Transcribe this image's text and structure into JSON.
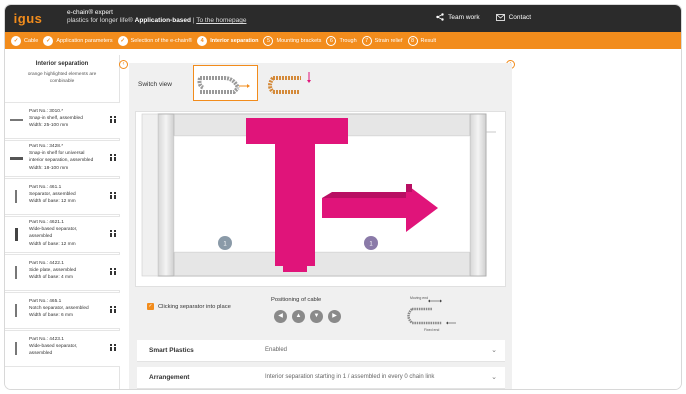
{
  "header": {
    "logo": "igus",
    "app_name": "e-chain® expert",
    "tagline": "plastics for longer life®",
    "mode": "Application-based",
    "separator": "|",
    "home_link": "To the homepage",
    "team_work": "Team work",
    "contact": "Contact"
  },
  "steps": [
    {
      "num": "✓",
      "label": "Cable",
      "state": "done"
    },
    {
      "num": "✓",
      "label": "Application parameters",
      "state": "done"
    },
    {
      "num": "✓",
      "label": "Selection of the e-chain®",
      "state": "done"
    },
    {
      "num": "4",
      "label": "Interior separation",
      "state": "active"
    },
    {
      "num": "5",
      "label": "Mounting brackets",
      "state": "todo"
    },
    {
      "num": "6",
      "label": "Trough",
      "state": "todo"
    },
    {
      "num": "7",
      "label": "Strain relief",
      "state": "todo"
    },
    {
      "num": "8",
      "label": "Result",
      "state": "todo"
    }
  ],
  "sidebar": {
    "title": "Interior separation",
    "note": "orange highlighted elements are combinable",
    "items": [
      {
        "l1": "Part No.: 3010.*",
        "l2": "Snap-in shelf, assembled",
        "l3": "Width: 25-100 mm",
        "icon": "horizontal-shelf-icon"
      },
      {
        "l1": "Part No.: 3428.*",
        "l2": "Snap-in shelf for universal",
        "l3": "interior separation, assembled",
        "l4": "Width: 18-100 mm",
        "icon": "universal-shelf-icon"
      },
      {
        "l1": "Part No.: 461.1",
        "l2": "Separator, assembled",
        "l3": "Width of base: 12 mm",
        "icon": "separator-icon"
      },
      {
        "l1": "Part No.: 4621.1",
        "l2": "Wide-based separator,",
        "l3": "assembled",
        "l4": "Width of base: 12 mm",
        "icon": "wide-separator-icon"
      },
      {
        "l1": "Part No.: 4422.1",
        "l2": "Side plate, assembled",
        "l3": "Width of base: 4 mm",
        "icon": "side-plate-icon"
      },
      {
        "l1": "Part No.: 465.1",
        "l2": "Notch separator, assembled",
        "l3": "Width of base: 6 mm",
        "icon": "notch-separator-icon"
      },
      {
        "l1": "Part No.: 4423.1",
        "l2": "Wide-based separator,",
        "l3": "assembled",
        "icon": "wide-separator-2-icon"
      }
    ]
  },
  "main": {
    "switch_view_label": "Switch view",
    "canvas_labels": {
      "left": "1",
      "right": "1"
    },
    "checkbox_label": "Clicking separator into place",
    "checkbox_mark": "✓",
    "positioning_label": "Positioning of cable",
    "pos_buttons": [
      "◀",
      "▲",
      "▼",
      "▶"
    ],
    "diagram_top": "Moving end",
    "diagram_bottom": "Fixed end"
  },
  "accordion": [
    {
      "key": "Smart Plastics",
      "value": "Enabled",
      "chev": "⌄"
    },
    {
      "key": "Arrangement",
      "value": "Interior separation starting in 1 / assembled in every 0 chain link",
      "chev": "⌄"
    }
  ],
  "colors": {
    "accent": "#f28c1c",
    "header": "#2b2b2b",
    "magenta": "#e0147a"
  }
}
